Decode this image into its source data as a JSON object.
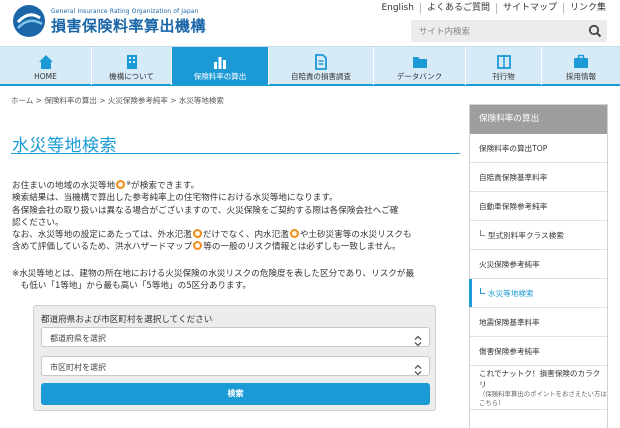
{
  "header": {
    "org_en": "General Insurance Rating Organization of Japan",
    "org_ja": "損害保険料率算出機構",
    "top_links": [
      "English",
      "よくあるご質問",
      "サイトマップ",
      "リンク集"
    ],
    "search_placeholder": "サイト内検索"
  },
  "nav": [
    {
      "label": "HOME",
      "icon": "home-icon",
      "active": false
    },
    {
      "label": "機構について",
      "icon": "building-icon",
      "active": false
    },
    {
      "label": "保険料率の算出",
      "icon": "bar-chart-icon",
      "active": true
    },
    {
      "label": "自賠責の損害調査",
      "icon": "document-icon",
      "active": false
    },
    {
      "label": "データバンク",
      "icon": "folder-icon",
      "active": false
    },
    {
      "label": "刊行物",
      "icon": "book-icon",
      "active": false
    },
    {
      "label": "採用情報",
      "icon": "person-icon",
      "active": false
    }
  ],
  "breadcrumb": "ホーム > 保険料率の算出 > 火災保険参考純率 > 水災等地検索",
  "main": {
    "title": "水災等地検索",
    "p1": [
      [
        "お住まいの地域の水災等地",
        "marker",
        "※",
        "が検索できます。"
      ],
      [
        "検索結果は、当機構で算出した参考純率上の住宅物件における水災等地になります。"
      ],
      [
        "各保険会社の取り扱いは異なる場合がございますので、火災保険をご契約する際は各保険会社へご確"
      ],
      [
        "認ください。"
      ],
      [
        "なお、水災等地の設定にあたっては、外水氾濫",
        "marker",
        "だけでなく、内水氾濫",
        "marker",
        "や土砂災害等の水災リスクも"
      ],
      [
        "含めて評価しているため、洪水ハザードマップ",
        "marker",
        "等の一般のリスク情報とは必ずしも一致しません。"
      ]
    ],
    "p2": [
      "※水災等地とは、建物の所在地における火災保険の水災リスクの危険度を表した区分であり、リスクが最",
      "　も低い「1等地」から最も高い「5等地」の5区分あります。"
    ],
    "form": {
      "label": "都道府県および市区町村を選択してください",
      "prefecture": "都道府県を選択",
      "city": "市区町村を選択",
      "button": "検索"
    }
  },
  "sidebar": {
    "heading": "保険料率の算出",
    "items": [
      {
        "label": "保険料率の算出TOP",
        "sub": false,
        "active": false
      },
      {
        "label": "自賠責保険基準料率",
        "sub": false,
        "active": false
      },
      {
        "label": "自動車保険参考純率",
        "sub": false,
        "active": false
      },
      {
        "label": "型式別料率クラス検索",
        "sub": true,
        "active": false
      },
      {
        "label": "火災保険参考純率",
        "sub": false,
        "active": false
      },
      {
        "label": "水災等地検索",
        "sub": true,
        "active": true
      },
      {
        "label": "地震保険基準料率",
        "sub": false,
        "active": false
      },
      {
        "label": "傷害保険参考純率",
        "sub": false,
        "active": false
      },
      {
        "label": "これでナットク！損害保険のカラクリ",
        "note": "（保険料率算出のポイントをおさえたい方はこちら）",
        "sub": false,
        "active": false
      }
    ]
  },
  "colors": {
    "accent": "#1c9ad6",
    "nav_bg": "#d6ebf7",
    "marker": "#f08c1c"
  }
}
